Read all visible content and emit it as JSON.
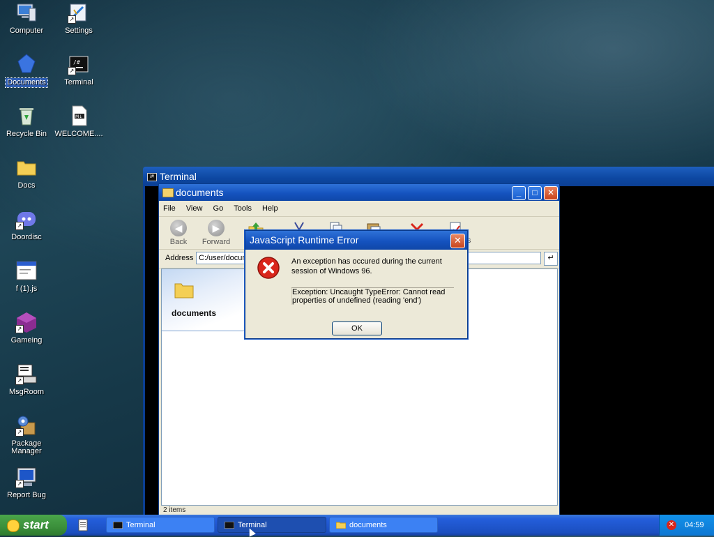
{
  "desktop": {
    "icons": [
      {
        "label": "Computer",
        "icon": "computer-icon"
      },
      {
        "label": "Settings",
        "icon": "settings-icon"
      },
      {
        "label": "Documents",
        "icon": "documents-icon"
      },
      {
        "label": "Terminal",
        "icon": "terminal-icon"
      },
      {
        "label": "Recycle Bin",
        "icon": "recycle-bin-icon"
      },
      {
        "label": "WELCOME....",
        "icon": "markdown-file-icon"
      },
      {
        "label": "Docs",
        "icon": "folder-icon"
      },
      {
        "label": "Doordisc",
        "icon": "discord-icon"
      },
      {
        "label": "f (1).js",
        "icon": "js-file-icon"
      },
      {
        "label": "Gameing",
        "icon": "game-icon"
      },
      {
        "label": "MsgRoom",
        "icon": "msgroom-icon"
      },
      {
        "label": "Package Manager",
        "icon": "package-manager-icon"
      },
      {
        "label": "Report Bug",
        "icon": "report-bug-icon"
      }
    ]
  },
  "terminal_window": {
    "title": "Terminal",
    "icon_text": "/#"
  },
  "docs_window": {
    "title": "documents",
    "menu": [
      "File",
      "View",
      "Go",
      "Tools",
      "Help"
    ],
    "toolbar": {
      "back_label": "Back",
      "forward_label": "Forward",
      "partial_label": "s"
    },
    "address_label": "Address",
    "address_value": "C:/user/documents",
    "folder_pane_title": "documents",
    "status": "2 items"
  },
  "error_dialog": {
    "title": "JavaScript Runtime Error",
    "message": "An exception has occured during the current session of Windows 96.",
    "details": "Exception: Uncaught TypeError: Cannot read properties of undefined (reading 'end')",
    "ok_label": "OK"
  },
  "taskbar": {
    "start_label": "start",
    "tasks": [
      {
        "label": "Terminal",
        "icon": "terminal-icon"
      },
      {
        "label": "Terminal",
        "icon": "terminal-icon"
      },
      {
        "label": "documents",
        "icon": "folder-icon"
      }
    ],
    "clock": "04:59"
  },
  "colors": {
    "titlebar": "#1553bf",
    "taskbar": "#245edb",
    "start": "#3b8f3b",
    "error": "#d9261c"
  }
}
